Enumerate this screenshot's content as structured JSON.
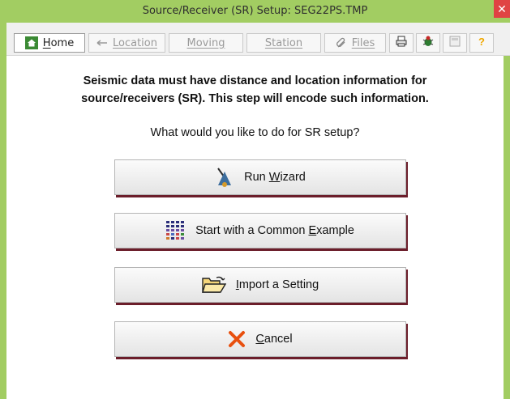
{
  "window": {
    "title": "Source/Receiver (SR) Setup: SEG22PS.TMP",
    "close_glyph": "✕"
  },
  "tabs": [
    {
      "label": "Home",
      "icon": "home-icon",
      "active": true
    },
    {
      "label": "Location",
      "icon": "arrow-left-icon",
      "active": false
    },
    {
      "label": "Moving",
      "icon": "",
      "active": false
    },
    {
      "label": "Station",
      "icon": "",
      "active": false
    },
    {
      "label": "Files",
      "icon": "files-icon",
      "active": false
    }
  ],
  "toolbar_icons": [
    "print-icon",
    "bug-icon",
    "calculator-icon",
    "help-icon"
  ],
  "content": {
    "heading_line1": "Seismic data must have distance and location information for",
    "heading_line2": "source/receivers (SR).  This step will encode such information.",
    "question": "What would you like to do for SR setup?"
  },
  "buttons": {
    "wizard": {
      "pre": "Run ",
      "u": "W",
      "post": "izard",
      "icon": "wizard-icon"
    },
    "example": {
      "pre": "Start with a Common ",
      "u": "E",
      "post": "xample",
      "icon": "grid-icon"
    },
    "import": {
      "pre": "",
      "u": "I",
      "post": "mport a Setting",
      "icon": "folder-open-icon"
    },
    "cancel": {
      "pre": "",
      "u": "C",
      "post": "ancel",
      "icon": "x-icon"
    }
  },
  "colors": {
    "accent": "#a2cd62",
    "button_shadow": "#6b1d2a",
    "cancel_x": "#e8500f"
  }
}
